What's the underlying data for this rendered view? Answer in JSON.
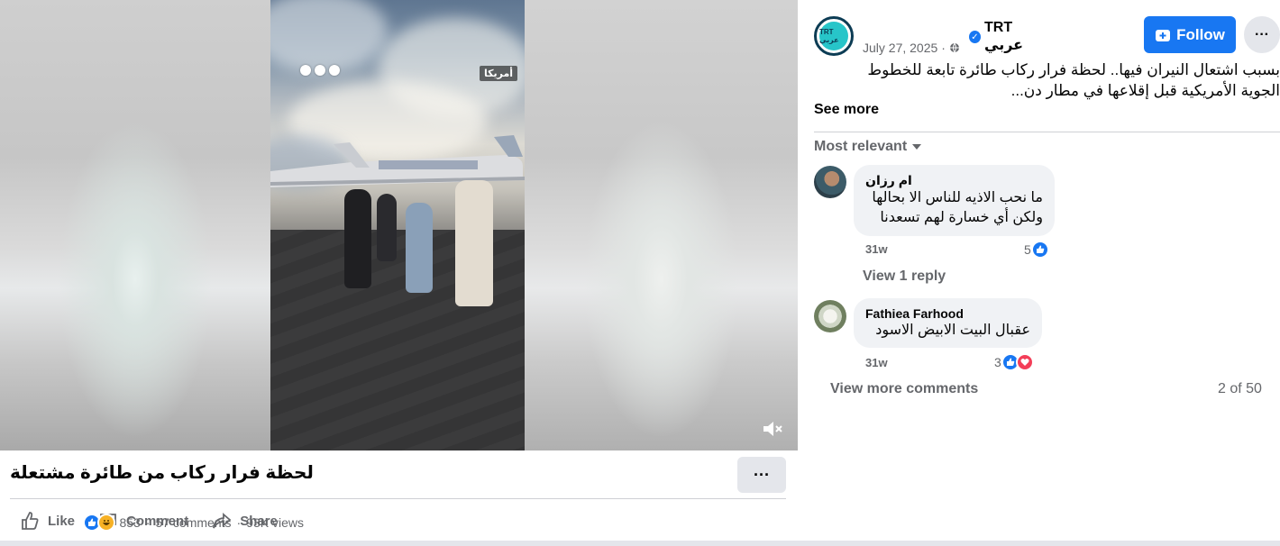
{
  "video": {
    "location_tag": "أمريكا",
    "mute_icon": "speaker-muted-icon"
  },
  "post": {
    "title": "لحظة فرار ركاب من طائرة مشتعلة",
    "more_label": "···",
    "actions": {
      "like": "Like",
      "comment": "Comment",
      "share": "Share"
    },
    "stats": {
      "reactions": "853",
      "comments": "57 comments",
      "views": "93K views",
      "separator": "·"
    }
  },
  "sidebar": {
    "page_name": "TRT عربي",
    "avatar_text": "TRT عربي",
    "date": "July 27, 2025",
    "date_separator": "·",
    "follow_label": "Follow",
    "more_label": "···",
    "post_text": "بسبب اشتعال النيران فيها.. لحظة فرار ركاب طائرة تابعة للخطوط الجوية الأمريكية قبل إقلاعها في مطار دن...",
    "see_more": "See more",
    "sort_label": "Most relevant",
    "comments": [
      {
        "author": "ام رزان",
        "text_line1": "ما نحب الاذيه للناس الا بحالها",
        "text_line2": "ولكن أي خسارة لهم تسعدنا",
        "time": "31w",
        "reactions": "5"
      },
      {
        "author": "Fathiea Farhood",
        "text_line1": "عقبال البيت الابيض الاسود",
        "time": "31w",
        "reactions": "3"
      }
    ],
    "view_reply": "View 1 reply",
    "view_more": "View more comments",
    "pager": "2 of 50"
  },
  "colors": {
    "accent": "#1877f2",
    "love": "#f33e58",
    "haha": "#f7b125",
    "muted_text": "#65676b"
  }
}
